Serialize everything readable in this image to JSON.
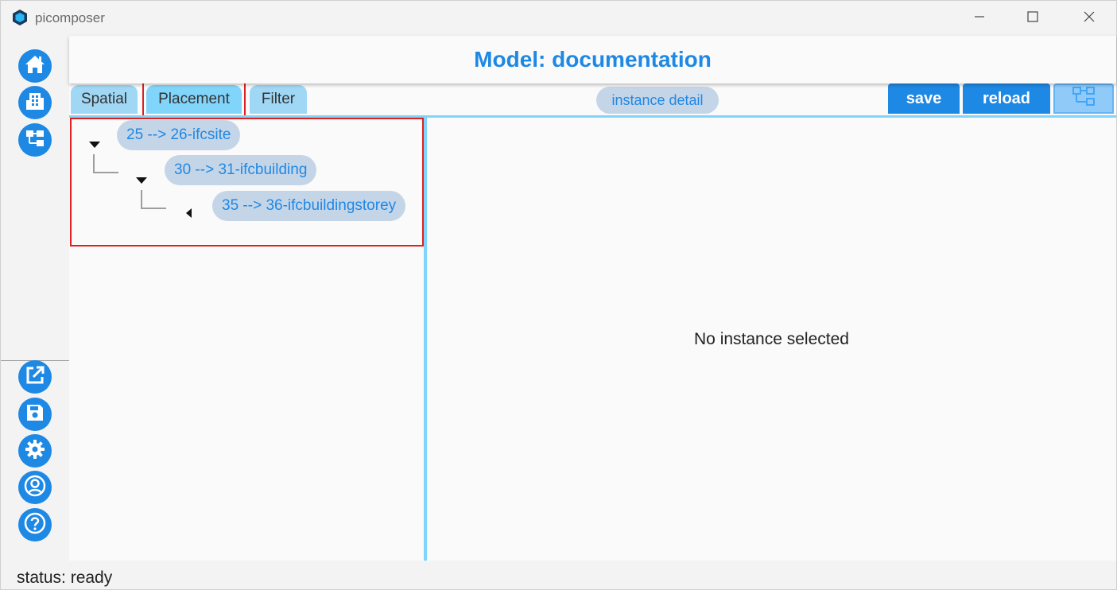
{
  "window": {
    "title": "picomposer",
    "app_icon": "picomposer-hexagon-icon",
    "controls": [
      "minimize-icon",
      "maximize-icon",
      "close-icon"
    ]
  },
  "sidebar": {
    "top_items": [
      {
        "name": "home",
        "icon": "home-icon"
      },
      {
        "name": "building",
        "icon": "building-icon"
      },
      {
        "name": "tree",
        "icon": "hierarchy-tree-icon"
      }
    ],
    "bottom_items": [
      {
        "name": "open-external",
        "icon": "open-external-icon"
      },
      {
        "name": "save",
        "icon": "floppy-save-icon"
      },
      {
        "name": "settings",
        "icon": "gear-icon"
      },
      {
        "name": "account",
        "icon": "account-icon"
      },
      {
        "name": "help",
        "icon": "help-icon"
      }
    ]
  },
  "header": {
    "title": "Model: documentation"
  },
  "tabs": [
    {
      "label": "Spatial",
      "active": false
    },
    {
      "label": "Placement",
      "active": true
    },
    {
      "label": "Filter",
      "active": false
    }
  ],
  "toolbar": {
    "detail_label": "instance detail",
    "save_label": "save",
    "reload_label": "reload",
    "tree_toggle_icon": "hierarchy-tree-icon"
  },
  "tree": [
    {
      "label": "25 --> 26-ifcsite",
      "level": 0,
      "expanded": true
    },
    {
      "label": "30 --> 31-ifcbuilding",
      "level": 1,
      "expanded": true
    },
    {
      "label": "35 --> 36-ifcbuildingstorey",
      "level": 2,
      "expanded": false
    }
  ],
  "detail": {
    "empty_message": "No instance selected"
  },
  "status": {
    "text": "status: ready"
  },
  "colors": {
    "accent": "#1e88e5",
    "tab_bg": "#9fd7f5",
    "chip_bg": "#c5d5e8",
    "divider": "#81d4fa",
    "highlight": "#e02020"
  }
}
